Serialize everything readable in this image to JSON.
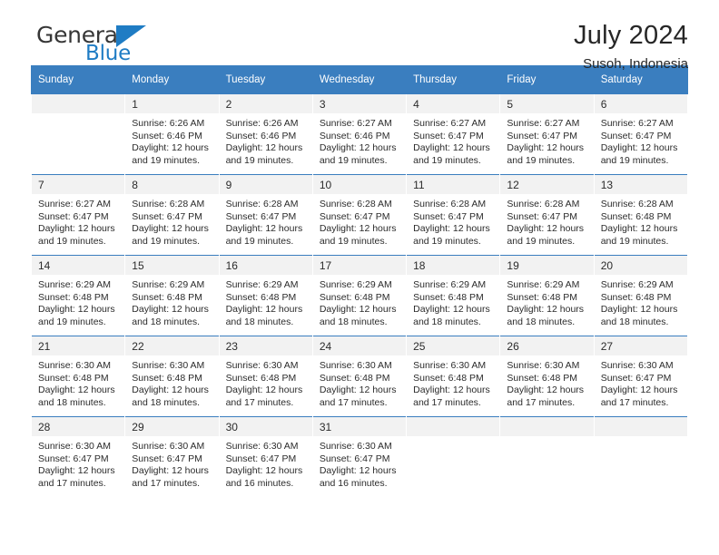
{
  "brand": {
    "name_top": "General",
    "name_bottom": "Blue",
    "triangle_icon": "triangle-icon",
    "color": "#1f7cc4"
  },
  "header": {
    "title": "July 2024",
    "subtitle": "Susoh, Indonesia"
  },
  "calendar": {
    "header_bg": "#3a7ebf",
    "daynum_bg": "#f2f2f2",
    "weekdays": [
      "Sunday",
      "Monday",
      "Tuesday",
      "Wednesday",
      "Thursday",
      "Friday",
      "Saturday"
    ],
    "weeks": [
      [
        {
          "day": "",
          "sunrise": "",
          "sunset": "",
          "daylight_line1": "",
          "daylight_line2": ""
        },
        {
          "day": "1",
          "sunrise": "Sunrise: 6:26 AM",
          "sunset": "Sunset: 6:46 PM",
          "daylight_line1": "Daylight: 12 hours",
          "daylight_line2": "and 19 minutes."
        },
        {
          "day": "2",
          "sunrise": "Sunrise: 6:26 AM",
          "sunset": "Sunset: 6:46 PM",
          "daylight_line1": "Daylight: 12 hours",
          "daylight_line2": "and 19 minutes."
        },
        {
          "day": "3",
          "sunrise": "Sunrise: 6:27 AM",
          "sunset": "Sunset: 6:46 PM",
          "daylight_line1": "Daylight: 12 hours",
          "daylight_line2": "and 19 minutes."
        },
        {
          "day": "4",
          "sunrise": "Sunrise: 6:27 AM",
          "sunset": "Sunset: 6:47 PM",
          "daylight_line1": "Daylight: 12 hours",
          "daylight_line2": "and 19 minutes."
        },
        {
          "day": "5",
          "sunrise": "Sunrise: 6:27 AM",
          "sunset": "Sunset: 6:47 PM",
          "daylight_line1": "Daylight: 12 hours",
          "daylight_line2": "and 19 minutes."
        },
        {
          "day": "6",
          "sunrise": "Sunrise: 6:27 AM",
          "sunset": "Sunset: 6:47 PM",
          "daylight_line1": "Daylight: 12 hours",
          "daylight_line2": "and 19 minutes."
        }
      ],
      [
        {
          "day": "7",
          "sunrise": "Sunrise: 6:27 AM",
          "sunset": "Sunset: 6:47 PM",
          "daylight_line1": "Daylight: 12 hours",
          "daylight_line2": "and 19 minutes."
        },
        {
          "day": "8",
          "sunrise": "Sunrise: 6:28 AM",
          "sunset": "Sunset: 6:47 PM",
          "daylight_line1": "Daylight: 12 hours",
          "daylight_line2": "and 19 minutes."
        },
        {
          "day": "9",
          "sunrise": "Sunrise: 6:28 AM",
          "sunset": "Sunset: 6:47 PM",
          "daylight_line1": "Daylight: 12 hours",
          "daylight_line2": "and 19 minutes."
        },
        {
          "day": "10",
          "sunrise": "Sunrise: 6:28 AM",
          "sunset": "Sunset: 6:47 PM",
          "daylight_line1": "Daylight: 12 hours",
          "daylight_line2": "and 19 minutes."
        },
        {
          "day": "11",
          "sunrise": "Sunrise: 6:28 AM",
          "sunset": "Sunset: 6:47 PM",
          "daylight_line1": "Daylight: 12 hours",
          "daylight_line2": "and 19 minutes."
        },
        {
          "day": "12",
          "sunrise": "Sunrise: 6:28 AM",
          "sunset": "Sunset: 6:47 PM",
          "daylight_line1": "Daylight: 12 hours",
          "daylight_line2": "and 19 minutes."
        },
        {
          "day": "13",
          "sunrise": "Sunrise: 6:28 AM",
          "sunset": "Sunset: 6:48 PM",
          "daylight_line1": "Daylight: 12 hours",
          "daylight_line2": "and 19 minutes."
        }
      ],
      [
        {
          "day": "14",
          "sunrise": "Sunrise: 6:29 AM",
          "sunset": "Sunset: 6:48 PM",
          "daylight_line1": "Daylight: 12 hours",
          "daylight_line2": "and 19 minutes."
        },
        {
          "day": "15",
          "sunrise": "Sunrise: 6:29 AM",
          "sunset": "Sunset: 6:48 PM",
          "daylight_line1": "Daylight: 12 hours",
          "daylight_line2": "and 18 minutes."
        },
        {
          "day": "16",
          "sunrise": "Sunrise: 6:29 AM",
          "sunset": "Sunset: 6:48 PM",
          "daylight_line1": "Daylight: 12 hours",
          "daylight_line2": "and 18 minutes."
        },
        {
          "day": "17",
          "sunrise": "Sunrise: 6:29 AM",
          "sunset": "Sunset: 6:48 PM",
          "daylight_line1": "Daylight: 12 hours",
          "daylight_line2": "and 18 minutes."
        },
        {
          "day": "18",
          "sunrise": "Sunrise: 6:29 AM",
          "sunset": "Sunset: 6:48 PM",
          "daylight_line1": "Daylight: 12 hours",
          "daylight_line2": "and 18 minutes."
        },
        {
          "day": "19",
          "sunrise": "Sunrise: 6:29 AM",
          "sunset": "Sunset: 6:48 PM",
          "daylight_line1": "Daylight: 12 hours",
          "daylight_line2": "and 18 minutes."
        },
        {
          "day": "20",
          "sunrise": "Sunrise: 6:29 AM",
          "sunset": "Sunset: 6:48 PM",
          "daylight_line1": "Daylight: 12 hours",
          "daylight_line2": "and 18 minutes."
        }
      ],
      [
        {
          "day": "21",
          "sunrise": "Sunrise: 6:30 AM",
          "sunset": "Sunset: 6:48 PM",
          "daylight_line1": "Daylight: 12 hours",
          "daylight_line2": "and 18 minutes."
        },
        {
          "day": "22",
          "sunrise": "Sunrise: 6:30 AM",
          "sunset": "Sunset: 6:48 PM",
          "daylight_line1": "Daylight: 12 hours",
          "daylight_line2": "and 18 minutes."
        },
        {
          "day": "23",
          "sunrise": "Sunrise: 6:30 AM",
          "sunset": "Sunset: 6:48 PM",
          "daylight_line1": "Daylight: 12 hours",
          "daylight_line2": "and 17 minutes."
        },
        {
          "day": "24",
          "sunrise": "Sunrise: 6:30 AM",
          "sunset": "Sunset: 6:48 PM",
          "daylight_line1": "Daylight: 12 hours",
          "daylight_line2": "and 17 minutes."
        },
        {
          "day": "25",
          "sunrise": "Sunrise: 6:30 AM",
          "sunset": "Sunset: 6:48 PM",
          "daylight_line1": "Daylight: 12 hours",
          "daylight_line2": "and 17 minutes."
        },
        {
          "day": "26",
          "sunrise": "Sunrise: 6:30 AM",
          "sunset": "Sunset: 6:48 PM",
          "daylight_line1": "Daylight: 12 hours",
          "daylight_line2": "and 17 minutes."
        },
        {
          "day": "27",
          "sunrise": "Sunrise: 6:30 AM",
          "sunset": "Sunset: 6:47 PM",
          "daylight_line1": "Daylight: 12 hours",
          "daylight_line2": "and 17 minutes."
        }
      ],
      [
        {
          "day": "28",
          "sunrise": "Sunrise: 6:30 AM",
          "sunset": "Sunset: 6:47 PM",
          "daylight_line1": "Daylight: 12 hours",
          "daylight_line2": "and 17 minutes."
        },
        {
          "day": "29",
          "sunrise": "Sunrise: 6:30 AM",
          "sunset": "Sunset: 6:47 PM",
          "daylight_line1": "Daylight: 12 hours",
          "daylight_line2": "and 17 minutes."
        },
        {
          "day": "30",
          "sunrise": "Sunrise: 6:30 AM",
          "sunset": "Sunset: 6:47 PM",
          "daylight_line1": "Daylight: 12 hours",
          "daylight_line2": "and 16 minutes."
        },
        {
          "day": "31",
          "sunrise": "Sunrise: 6:30 AM",
          "sunset": "Sunset: 6:47 PM",
          "daylight_line1": "Daylight: 12 hours",
          "daylight_line2": "and 16 minutes."
        },
        {
          "day": "",
          "sunrise": "",
          "sunset": "",
          "daylight_line1": "",
          "daylight_line2": ""
        },
        {
          "day": "",
          "sunrise": "",
          "sunset": "",
          "daylight_line1": "",
          "daylight_line2": ""
        },
        {
          "day": "",
          "sunrise": "",
          "sunset": "",
          "daylight_line1": "",
          "daylight_line2": ""
        }
      ]
    ]
  }
}
